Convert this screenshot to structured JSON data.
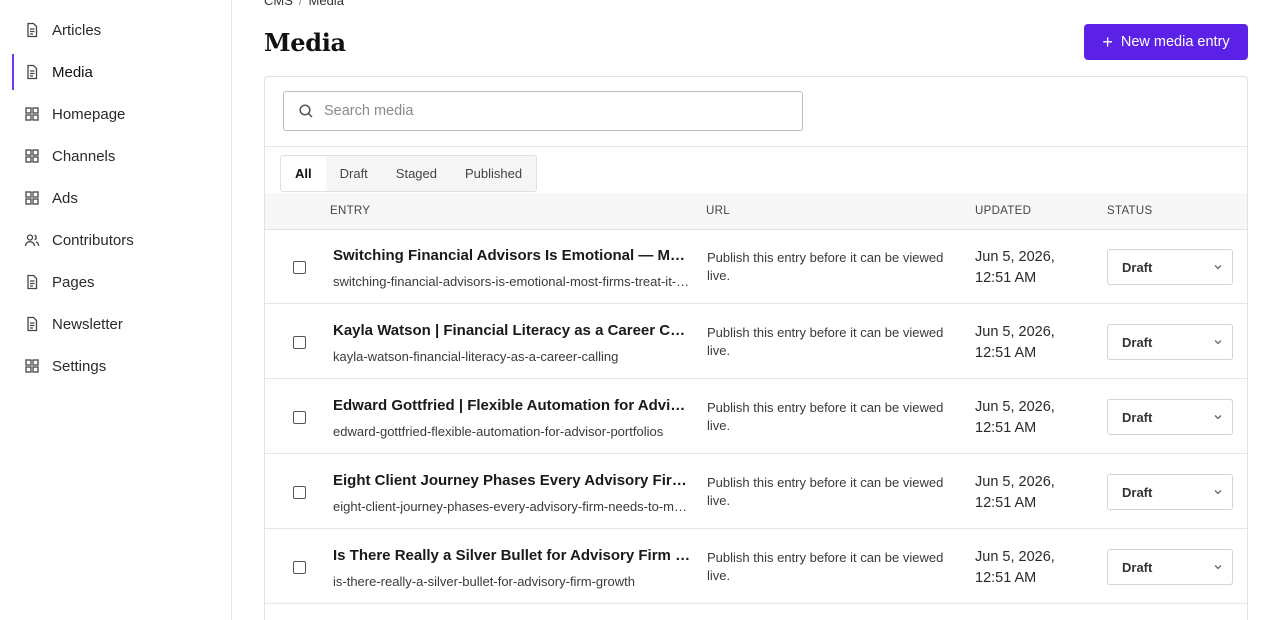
{
  "sidebar": {
    "items": [
      {
        "label": "Articles",
        "icon": "document-icon"
      },
      {
        "label": "Media",
        "icon": "document-icon",
        "active": true
      },
      {
        "label": "Homepage",
        "icon": "grid-icon"
      },
      {
        "label": "Channels",
        "icon": "grid-icon"
      },
      {
        "label": "Ads",
        "icon": "grid-icon"
      },
      {
        "label": "Contributors",
        "icon": "users-icon"
      },
      {
        "label": "Pages",
        "icon": "document-icon"
      },
      {
        "label": "Newsletter",
        "icon": "document-icon"
      },
      {
        "label": "Settings",
        "icon": "grid-icon"
      }
    ]
  },
  "breadcrumb": {
    "root": "CMS",
    "separator": "/",
    "current": "Media"
  },
  "header": {
    "title": "Media",
    "new_button_label": "New media entry"
  },
  "search": {
    "placeholder": "Search media",
    "value": ""
  },
  "tabs": [
    {
      "label": "All",
      "active": true
    },
    {
      "label": "Draft"
    },
    {
      "label": "Staged"
    },
    {
      "label": "Published"
    }
  ],
  "table": {
    "columns": {
      "entry": "ENTRY",
      "url": "URL",
      "updated": "UPDATED",
      "status": "STATUS"
    },
    "rows": [
      {
        "title": "Switching Financial Advisors Is Emotional — Most Firms Treat It Like a Transaction",
        "slug": "switching-financial-advisors-is-emotional-most-firms-treat-it-like-a-transaction",
        "url": "Publish this entry before it can be viewed live.",
        "updated": "Jun 5, 2026, 12:51 AM",
        "status": "Draft"
      },
      {
        "title": "Kayla Watson | Financial Literacy as a Career Calling",
        "slug": "kayla-watson-financial-literacy-as-a-career-calling",
        "url": "Publish this entry before it can be viewed live.",
        "updated": "Jun 5, 2026, 12:51 AM",
        "status": "Draft"
      },
      {
        "title": "Edward Gottfried | Flexible Automation for Advisor Portfolios",
        "slug": "edward-gottfried-flexible-automation-for-advisor-portfolios",
        "url": "Publish this entry before it can be viewed live.",
        "updated": "Jun 5, 2026, 12:51 AM",
        "status": "Draft"
      },
      {
        "title": "Eight Client Journey Phases Every Advisory Firm Needs to Master",
        "slug": "eight-client-journey-phases-every-advisory-firm-needs-to-master",
        "url": "Publish this entry before it can be viewed live.",
        "updated": "Jun 5, 2026, 12:51 AM",
        "status": "Draft"
      },
      {
        "title": "Is There Really a Silver Bullet for Advisory Firm Growth?",
        "slug": "is-there-really-a-silver-bullet-for-advisory-firm-growth",
        "url": "Publish this entry before it can be viewed live.",
        "updated": "Jun 5, 2026, 12:51 AM",
        "status": "Draft"
      }
    ]
  },
  "colors": {
    "accent": "#5b21e6",
    "active_border": "#6d3af0"
  }
}
